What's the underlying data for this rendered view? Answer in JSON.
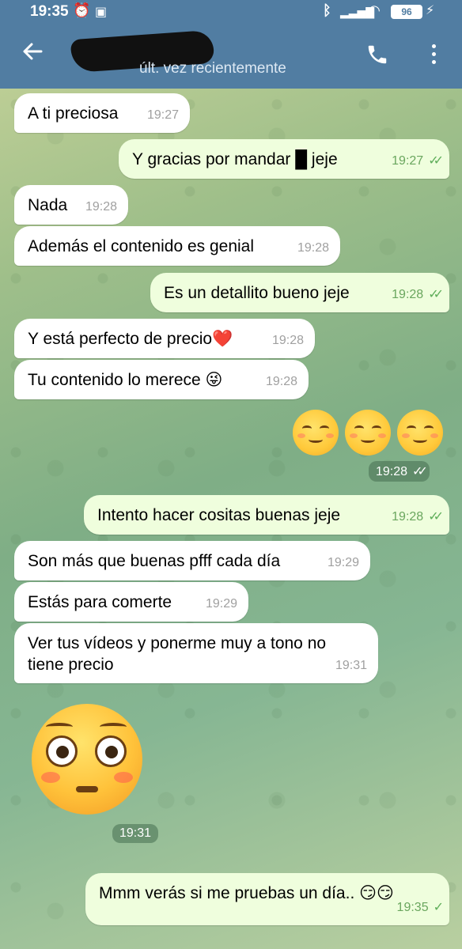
{
  "status_bar": {
    "time": "19:35",
    "battery": "96"
  },
  "header": {
    "contact_status": "últ. vez recientemente"
  },
  "messages": [
    {
      "text": "A ti preciosa",
      "time": "19:27"
    },
    {
      "text": "Y gracias por mandar █ jeje",
      "time": "19:27",
      "ticks": "✓✓"
    },
    {
      "text": "Nada",
      "time": "19:28"
    },
    {
      "text": "Además el contenido es genial",
      "time": "19:28"
    },
    {
      "text": "Es un detallito bueno jeje",
      "time": "19:28",
      "ticks": "✓✓"
    },
    {
      "text": "Y está perfecto de precio❤️",
      "time": "19:28"
    },
    {
      "text": "Tu contenido lo merece 😜",
      "time": "19:28"
    },
    {
      "text": "",
      "time": "19:28",
      "ticks": "✓✓"
    },
    {
      "text": "Intento hacer cositas buenas jeje",
      "time": "19:28",
      "ticks": "✓✓"
    },
    {
      "text": "Son más que buenas pfff cada día",
      "time": "19:29"
    },
    {
      "text": "Estás para comerte",
      "time": "19:29"
    },
    {
      "text": "Ver tus vídeos y ponerme muy a tono no\ntiene precio",
      "time": "19:31"
    },
    {
      "text": "",
      "time": "19:31"
    },
    {
      "text": "Mmm verás si me pruebas un día.. 😏😏",
      "time": "19:35",
      "ticks": "✓"
    }
  ],
  "colors": {
    "header": "#517da2",
    "incoming_bubble": "#ffffff",
    "outgoing_bubble": "#effedd"
  }
}
